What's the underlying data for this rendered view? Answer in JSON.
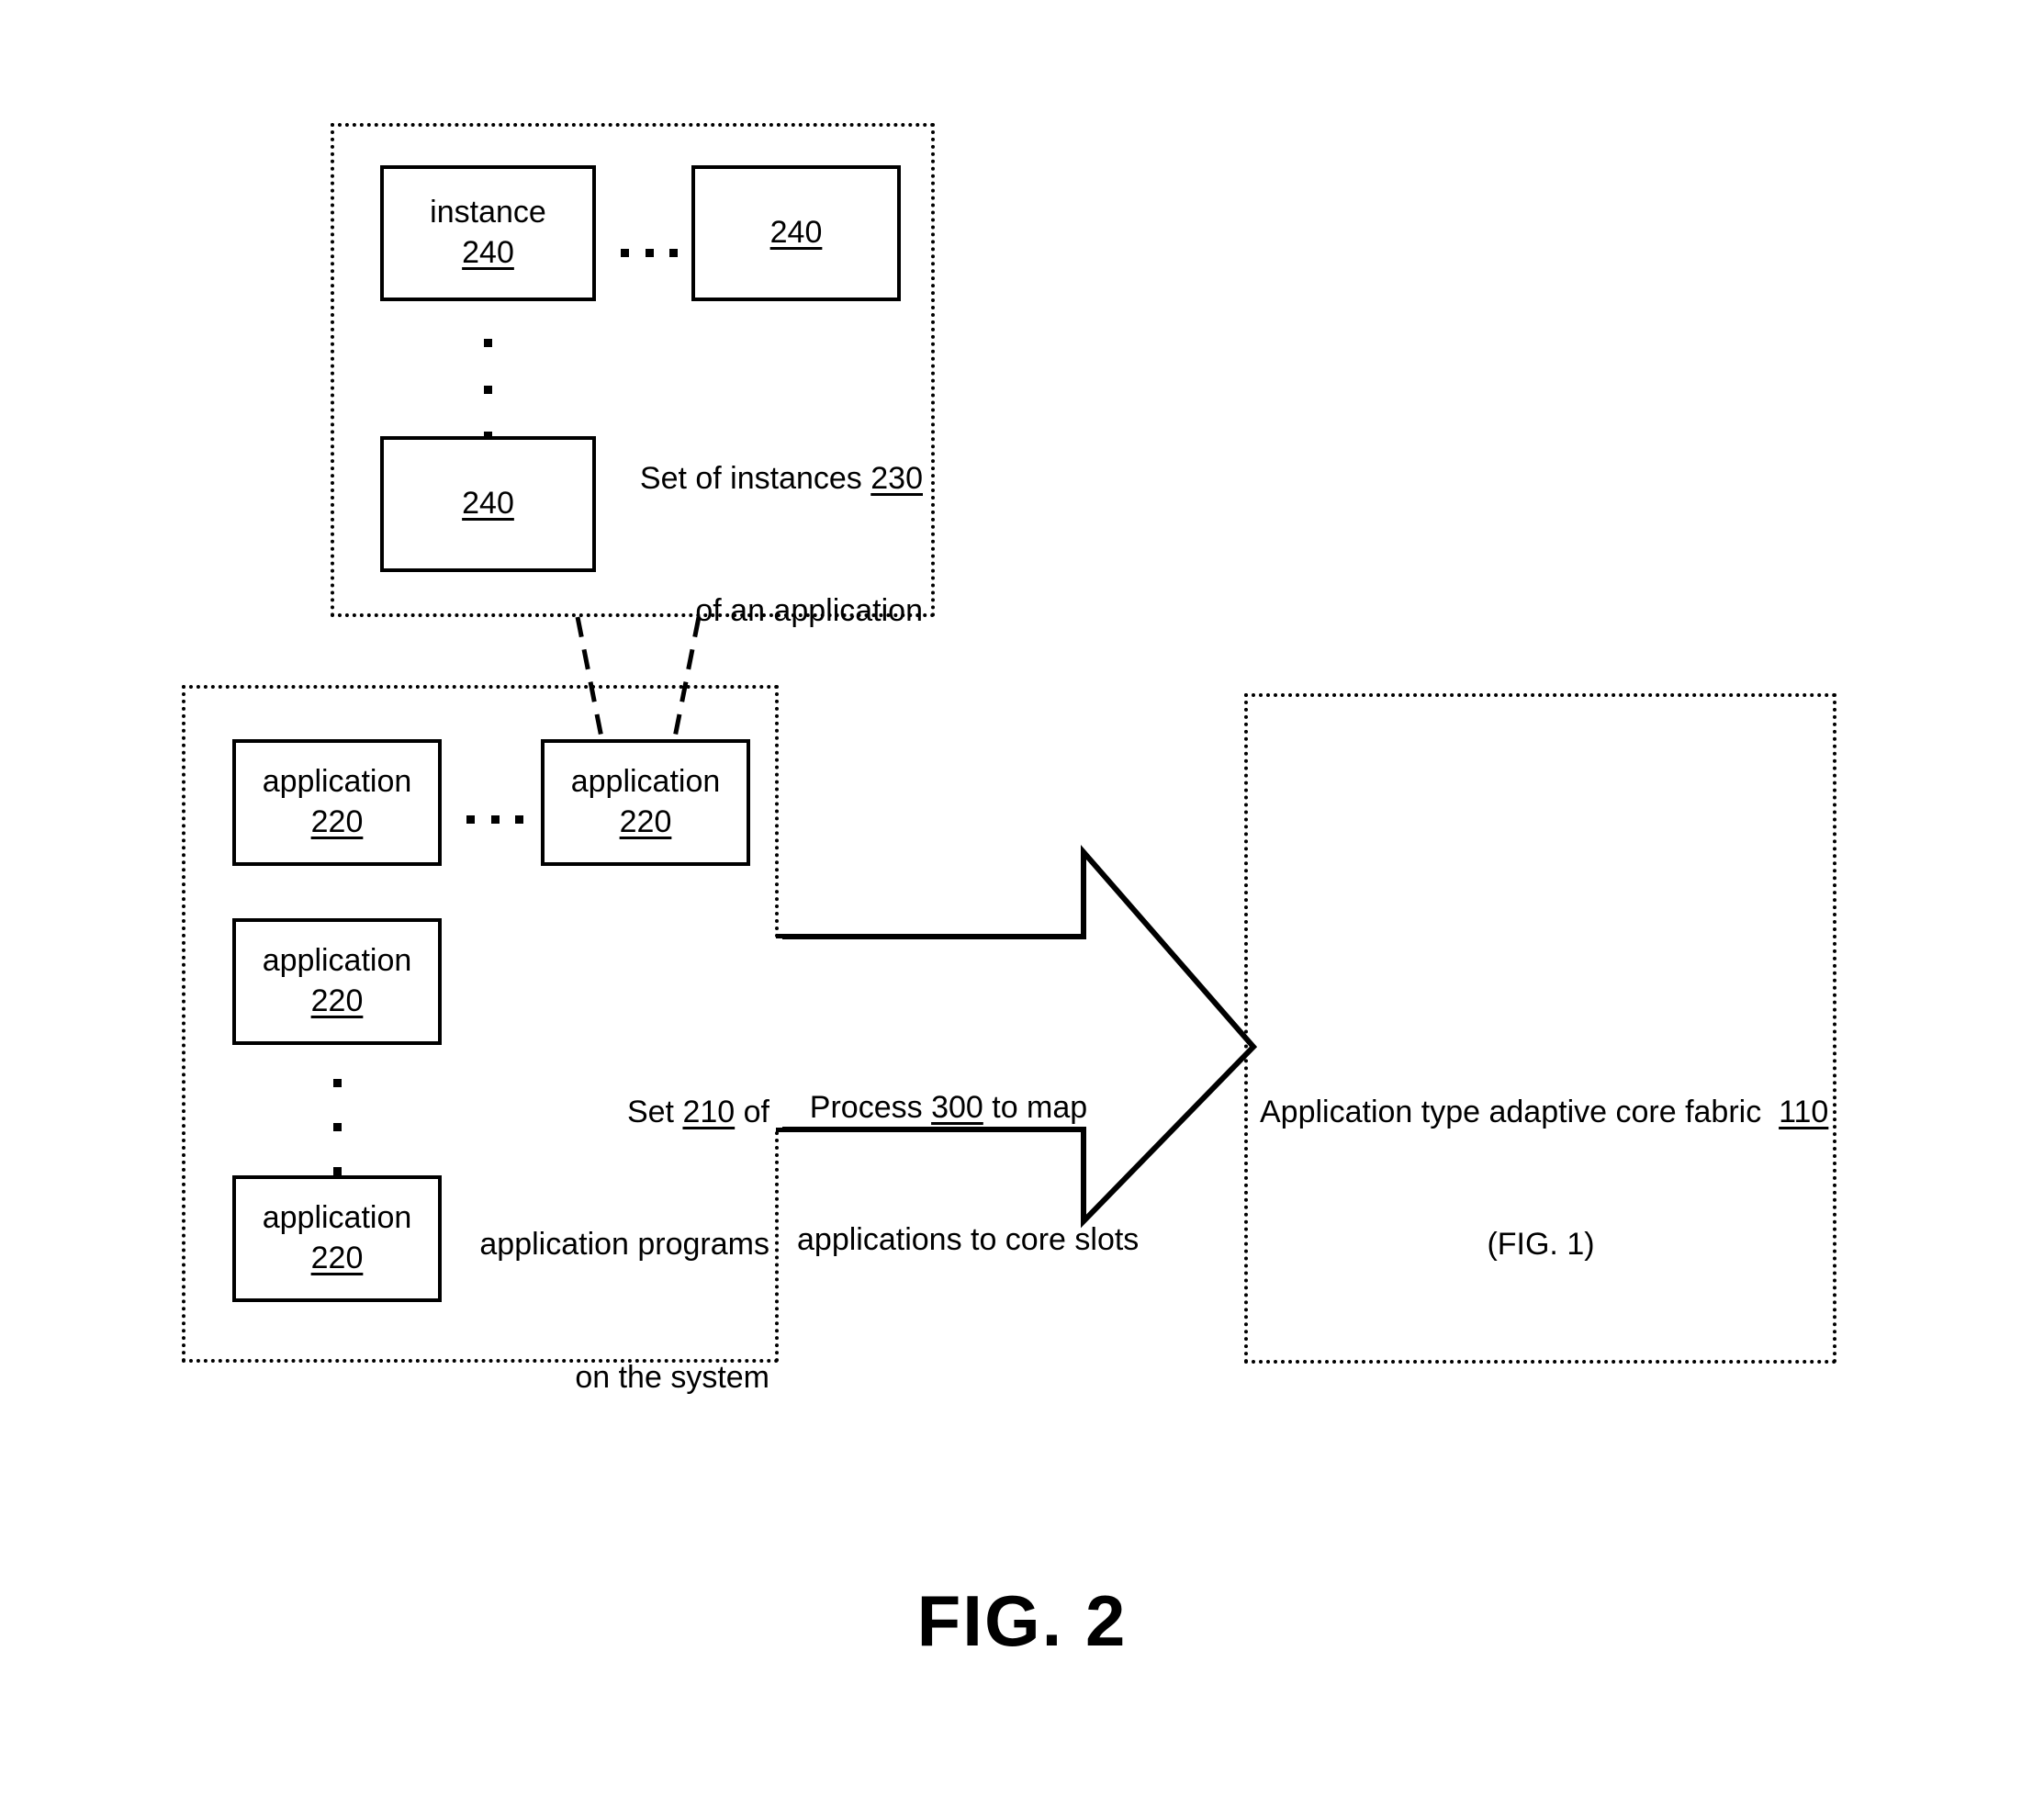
{
  "figure": {
    "caption": "FIG. 2"
  },
  "instances_group": {
    "name": "set-of-instances",
    "label_line1_prefix": "Set of instances ",
    "label_line1_ref": "230",
    "label_line2": "of an application",
    "boxes": [
      {
        "title": "instance",
        "ref": "240"
      },
      {
        "title": "",
        "ref": "240"
      },
      {
        "title": "",
        "ref": "240"
      }
    ],
    "horizontal_ellipsis": "· · ·",
    "vertical_ellipsis": "·\n·\n·"
  },
  "applications_group": {
    "name": "set-of-application-programs",
    "label_line1_prefix": "Set ",
    "label_line1_ref": "210",
    "label_line1_suffix": " of",
    "label_line2": "application programs",
    "label_line3": "on the system",
    "boxes": [
      {
        "title": "application",
        "ref": "220"
      },
      {
        "title": "application",
        "ref": "220"
      },
      {
        "title": "application",
        "ref": "220"
      },
      {
        "title": "application",
        "ref": "220"
      }
    ],
    "horizontal_ellipsis": "· · ·",
    "vertical_ellipsis": "·\n·\n·"
  },
  "process_arrow": {
    "name": "process-300-arrow",
    "label_line1_prefix": "Process ",
    "label_line1_ref": "300",
    "label_line1_suffix": " to map",
    "label_line2": "applications to core slots"
  },
  "core_fabric_group": {
    "name": "application-type-adaptive-core-fabric",
    "label_line1_prefix": "Application type adaptive core fabric  ",
    "label_line1_ref": "110",
    "label_line2": "(FIG. 1)"
  },
  "colors": {
    "stroke": "#000000",
    "fill": "#ffffff"
  }
}
